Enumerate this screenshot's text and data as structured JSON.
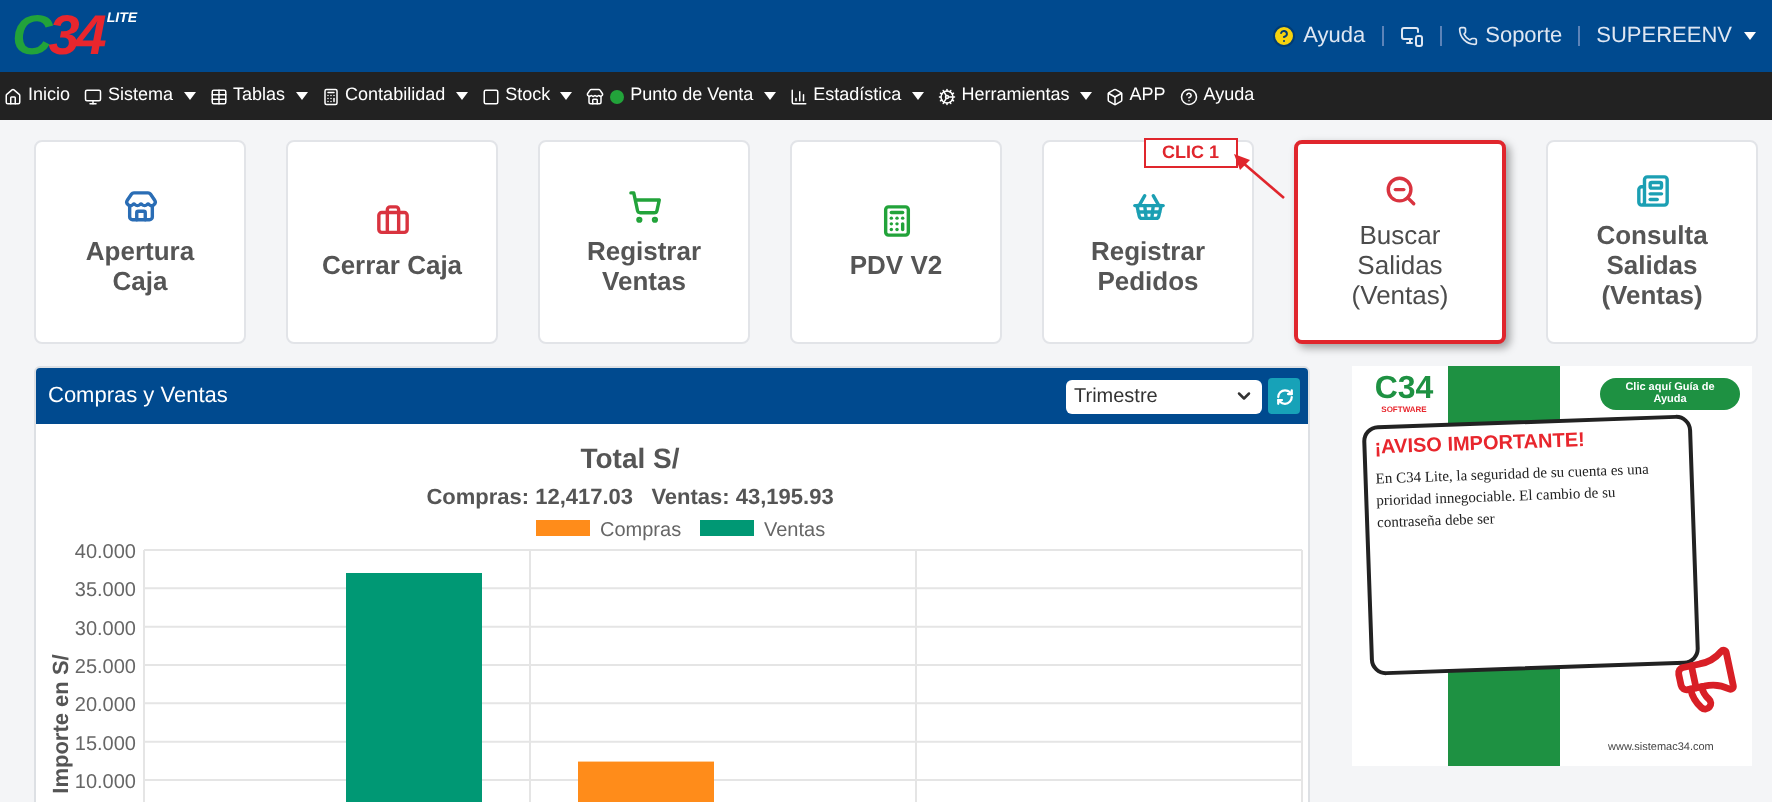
{
  "logo": {
    "text": "C34",
    "tag": "LITE"
  },
  "top_links": [
    {
      "kind": "help",
      "label": "Ayuda"
    },
    {
      "kind": "screen"
    },
    {
      "kind": "phone",
      "label": "Soporte"
    },
    {
      "kind": "user",
      "label": "SUPEREENV",
      "dropdown": true
    }
  ],
  "nav": [
    {
      "label": "Inicio",
      "dropdown": false
    },
    {
      "label": "Sistema",
      "dropdown": true
    },
    {
      "label": "Tablas",
      "dropdown": true
    },
    {
      "label": "Contabilidad",
      "dropdown": true
    },
    {
      "label": "Stock",
      "dropdown": true
    },
    {
      "label": "Punto de Venta",
      "dropdown": true
    },
    {
      "label": "Estadística",
      "dropdown": true
    },
    {
      "label": "Herramientas",
      "dropdown": true
    },
    {
      "label": "APP",
      "dropdown": false
    },
    {
      "label": "Ayuda",
      "dropdown": false
    }
  ],
  "cards": [
    {
      "label": "Apertura Caja",
      "highlighted": false
    },
    {
      "label": "Cerrar Caja",
      "highlighted": false
    },
    {
      "label": "Registrar Ventas",
      "highlighted": false
    },
    {
      "label": "PDV V2",
      "highlighted": false
    },
    {
      "label": "Registrar Pedidos",
      "highlighted": false
    },
    {
      "label": "Buscar Salidas (Ventas)",
      "highlighted": true
    },
    {
      "label": "Consulta Salidas (Ventas)",
      "highlighted": false
    }
  ],
  "callout": {
    "label": "CLIC 1"
  },
  "panel": {
    "title": "Compras y Ventas",
    "period_select": {
      "value": "Trimestre"
    },
    "chart_totals": "Compras: 12,417.03   Ventas: 43,195.93",
    "chart_data": {
      "type": "bar",
      "title": "Total S/",
      "grid": true,
      "legend": true,
      "ylabel": "Importe en S/",
      "series": [
        {
          "name": "Compras",
          "color": "#ff8c1a",
          "values": [
            null,
            12.4,
            null
          ]
        },
        {
          "name": "Ventas",
          "color": "#009874",
          "values": [
            37,
            null,
            null
          ]
        }
      ],
      "ylim": [
        0,
        40
      ],
      "yticks": [
        {
          "value": 10,
          "label": "10.000"
        },
        {
          "value": 15,
          "label": "15.000"
        },
        {
          "value": 20,
          "label": "20.000"
        },
        {
          "value": 25,
          "label": "25.000"
        },
        {
          "value": 30,
          "label": "30.000"
        },
        {
          "value": 35,
          "label": "35.000"
        },
        {
          "value": 40,
          "label": "40.000"
        }
      ]
    }
  },
  "banner": {
    "logo": "C34",
    "logo_sub": "SOFTWARE",
    "help_button": "Clic aquí Guía de Ayuda",
    "heading": "¡AVISO IMPORTANTE!",
    "body": "En C34 Lite, la seguridad de su cuenta es una prioridad innegociable. El cambio de su contraseña debe ser",
    "url": "www.sistemac34.com"
  }
}
